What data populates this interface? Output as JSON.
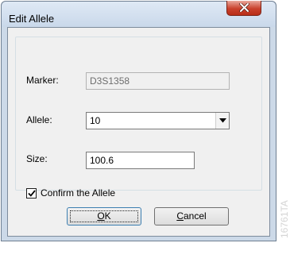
{
  "window": {
    "title": "Edit Allele",
    "close_icon": "close-x-icon"
  },
  "form": {
    "marker_label": "Marker:",
    "marker_value": "D3S1358",
    "allele_label": "Allele:",
    "allele_value": "10",
    "size_label": "Size:",
    "size_value": "100.6",
    "confirm_label": "Confirm the Allele",
    "confirm_checked": true
  },
  "buttons": {
    "ok_mnemonic": "O",
    "ok_rest": "K",
    "cancel_mnemonic": "C",
    "cancel_rest": "ancel"
  },
  "side_code": "16761TA",
  "colors": {
    "close_button": "#c9412c",
    "title_bar": "#dfe9f5",
    "dialog_face": "#f0f0f0"
  }
}
